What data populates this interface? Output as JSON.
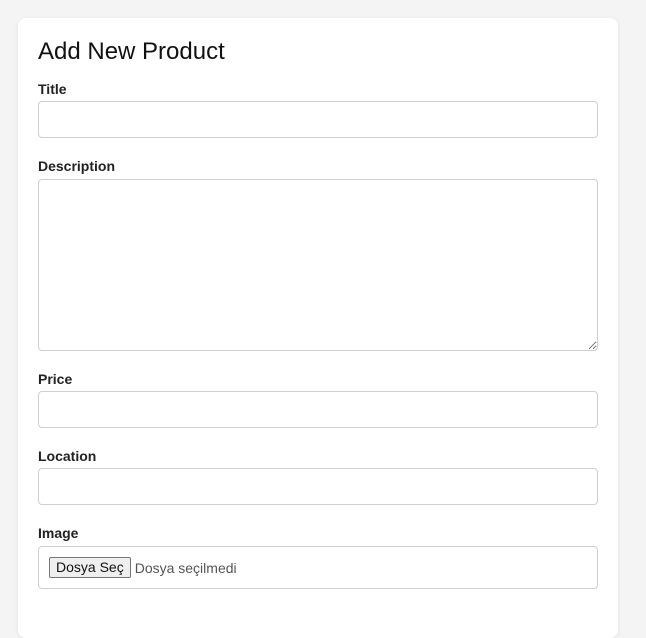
{
  "form": {
    "title": "Add New Product",
    "fields": {
      "title": {
        "label": "Title",
        "value": ""
      },
      "description": {
        "label": "Description",
        "value": ""
      },
      "price": {
        "label": "Price",
        "value": ""
      },
      "location": {
        "label": "Location",
        "value": ""
      },
      "image": {
        "label": "Image",
        "button_label": "Dosya Seç",
        "status": "Dosya seçilmedi"
      }
    }
  }
}
